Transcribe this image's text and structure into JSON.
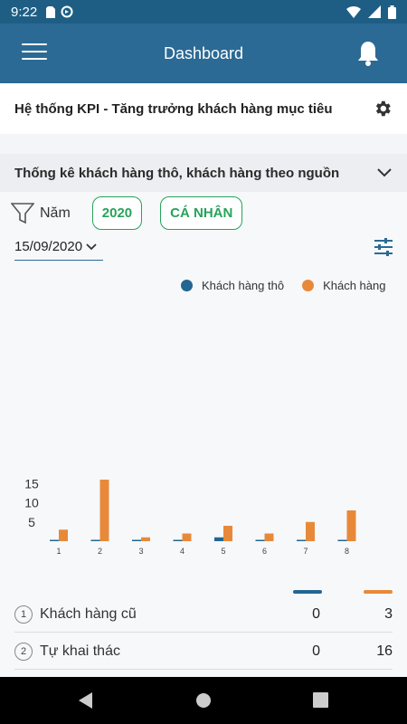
{
  "status_bar": {
    "time": "9:22"
  },
  "app_bar": {
    "title": "Dashboard"
  },
  "kpi": {
    "title": "Hệ thống KPI - Tăng trưởng khách hàng mục tiêu"
  },
  "section": {
    "title": "Thống kê khách hàng thô, khách hàng theo nguồn"
  },
  "filter": {
    "label": "Năm",
    "year_chip": "2020",
    "scope_chip": "CÁ NHÂN",
    "date": "15/09/2020"
  },
  "colors": {
    "primary": "#2b6a94",
    "series_raw": "#236692",
    "series_customer": "#e8893a",
    "chip": "#27a35a"
  },
  "chart_data": {
    "type": "bar",
    "categories": [
      "1",
      "2",
      "3",
      "4",
      "5",
      "6",
      "7",
      "8"
    ],
    "series": [
      {
        "name": "Khách hàng thô",
        "values": [
          0,
          0,
          0,
          0,
          1,
          0,
          0,
          0
        ]
      },
      {
        "name": "Khách hàng",
        "values": [
          3,
          16,
          1,
          2,
          4,
          2,
          5,
          8
        ]
      }
    ],
    "yticks": [
      5,
      10,
      15
    ],
    "ylim": [
      0,
      17
    ],
    "legend_position": "top-right",
    "grid": false
  },
  "table": {
    "rows": [
      {
        "index": "1",
        "label": "Khách hàng cũ",
        "raw": "0",
        "customer": "3"
      },
      {
        "index": "2",
        "label": "Tự khai thác",
        "raw": "0",
        "customer": "16"
      }
    ]
  }
}
